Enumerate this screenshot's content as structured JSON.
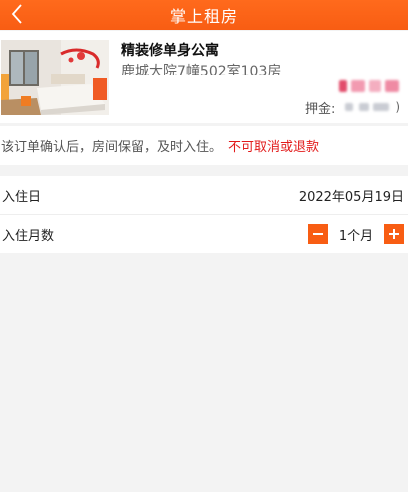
{
  "header": {
    "title": "掌上租房"
  },
  "listing": {
    "title": "精装修单身公寓",
    "address": "鹿城大院7幢502室103房",
    "deposit_label": "押金:",
    "deposit_suffix": ")"
  },
  "notice": {
    "text": "该订单确认后，房间保留，及时入住。",
    "warning": "不可取消或退款"
  },
  "form": {
    "checkin_label": "入住日",
    "checkin_value": "2022年05月19日",
    "months_label": "入住月数",
    "months_value": "1个月"
  },
  "colors": {
    "accent": "#f85d13",
    "warning": "#e21b1b"
  },
  "icons": {
    "back": "chevron-left-icon",
    "minus": "minus-icon",
    "plus": "plus-icon"
  }
}
